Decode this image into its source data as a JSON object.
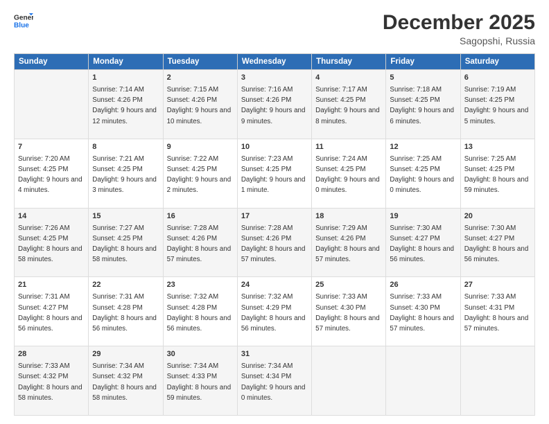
{
  "header": {
    "logo_line1": "General",
    "logo_line2": "Blue",
    "title": "December 2025",
    "subtitle": "Sagopshi, Russia"
  },
  "weekdays": [
    "Sunday",
    "Monday",
    "Tuesday",
    "Wednesday",
    "Thursday",
    "Friday",
    "Saturday"
  ],
  "weeks": [
    [
      {
        "day": "",
        "sunrise": "",
        "sunset": "",
        "daylight": ""
      },
      {
        "day": "1",
        "sunrise": "Sunrise: 7:14 AM",
        "sunset": "Sunset: 4:26 PM",
        "daylight": "Daylight: 9 hours and 12 minutes."
      },
      {
        "day": "2",
        "sunrise": "Sunrise: 7:15 AM",
        "sunset": "Sunset: 4:26 PM",
        "daylight": "Daylight: 9 hours and 10 minutes."
      },
      {
        "day": "3",
        "sunrise": "Sunrise: 7:16 AM",
        "sunset": "Sunset: 4:26 PM",
        "daylight": "Daylight: 9 hours and 9 minutes."
      },
      {
        "day": "4",
        "sunrise": "Sunrise: 7:17 AM",
        "sunset": "Sunset: 4:25 PM",
        "daylight": "Daylight: 9 hours and 8 minutes."
      },
      {
        "day": "5",
        "sunrise": "Sunrise: 7:18 AM",
        "sunset": "Sunset: 4:25 PM",
        "daylight": "Daylight: 9 hours and 6 minutes."
      },
      {
        "day": "6",
        "sunrise": "Sunrise: 7:19 AM",
        "sunset": "Sunset: 4:25 PM",
        "daylight": "Daylight: 9 hours and 5 minutes."
      }
    ],
    [
      {
        "day": "7",
        "sunrise": "Sunrise: 7:20 AM",
        "sunset": "Sunset: 4:25 PM",
        "daylight": "Daylight: 9 hours and 4 minutes."
      },
      {
        "day": "8",
        "sunrise": "Sunrise: 7:21 AM",
        "sunset": "Sunset: 4:25 PM",
        "daylight": "Daylight: 9 hours and 3 minutes."
      },
      {
        "day": "9",
        "sunrise": "Sunrise: 7:22 AM",
        "sunset": "Sunset: 4:25 PM",
        "daylight": "Daylight: 9 hours and 2 minutes."
      },
      {
        "day": "10",
        "sunrise": "Sunrise: 7:23 AM",
        "sunset": "Sunset: 4:25 PM",
        "daylight": "Daylight: 9 hours and 1 minute."
      },
      {
        "day": "11",
        "sunrise": "Sunrise: 7:24 AM",
        "sunset": "Sunset: 4:25 PM",
        "daylight": "Daylight: 9 hours and 0 minutes."
      },
      {
        "day": "12",
        "sunrise": "Sunrise: 7:25 AM",
        "sunset": "Sunset: 4:25 PM",
        "daylight": "Daylight: 9 hours and 0 minutes."
      },
      {
        "day": "13",
        "sunrise": "Sunrise: 7:25 AM",
        "sunset": "Sunset: 4:25 PM",
        "daylight": "Daylight: 8 hours and 59 minutes."
      }
    ],
    [
      {
        "day": "14",
        "sunrise": "Sunrise: 7:26 AM",
        "sunset": "Sunset: 4:25 PM",
        "daylight": "Daylight: 8 hours and 58 minutes."
      },
      {
        "day": "15",
        "sunrise": "Sunrise: 7:27 AM",
        "sunset": "Sunset: 4:25 PM",
        "daylight": "Daylight: 8 hours and 58 minutes."
      },
      {
        "day": "16",
        "sunrise": "Sunrise: 7:28 AM",
        "sunset": "Sunset: 4:26 PM",
        "daylight": "Daylight: 8 hours and 57 minutes."
      },
      {
        "day": "17",
        "sunrise": "Sunrise: 7:28 AM",
        "sunset": "Sunset: 4:26 PM",
        "daylight": "Daylight: 8 hours and 57 minutes."
      },
      {
        "day": "18",
        "sunrise": "Sunrise: 7:29 AM",
        "sunset": "Sunset: 4:26 PM",
        "daylight": "Daylight: 8 hours and 57 minutes."
      },
      {
        "day": "19",
        "sunrise": "Sunrise: 7:30 AM",
        "sunset": "Sunset: 4:27 PM",
        "daylight": "Daylight: 8 hours and 56 minutes."
      },
      {
        "day": "20",
        "sunrise": "Sunrise: 7:30 AM",
        "sunset": "Sunset: 4:27 PM",
        "daylight": "Daylight: 8 hours and 56 minutes."
      }
    ],
    [
      {
        "day": "21",
        "sunrise": "Sunrise: 7:31 AM",
        "sunset": "Sunset: 4:27 PM",
        "daylight": "Daylight: 8 hours and 56 minutes."
      },
      {
        "day": "22",
        "sunrise": "Sunrise: 7:31 AM",
        "sunset": "Sunset: 4:28 PM",
        "daylight": "Daylight: 8 hours and 56 minutes."
      },
      {
        "day": "23",
        "sunrise": "Sunrise: 7:32 AM",
        "sunset": "Sunset: 4:28 PM",
        "daylight": "Daylight: 8 hours and 56 minutes."
      },
      {
        "day": "24",
        "sunrise": "Sunrise: 7:32 AM",
        "sunset": "Sunset: 4:29 PM",
        "daylight": "Daylight: 8 hours and 56 minutes."
      },
      {
        "day": "25",
        "sunrise": "Sunrise: 7:33 AM",
        "sunset": "Sunset: 4:30 PM",
        "daylight": "Daylight: 8 hours and 57 minutes."
      },
      {
        "day": "26",
        "sunrise": "Sunrise: 7:33 AM",
        "sunset": "Sunset: 4:30 PM",
        "daylight": "Daylight: 8 hours and 57 minutes."
      },
      {
        "day": "27",
        "sunrise": "Sunrise: 7:33 AM",
        "sunset": "Sunset: 4:31 PM",
        "daylight": "Daylight: 8 hours and 57 minutes."
      }
    ],
    [
      {
        "day": "28",
        "sunrise": "Sunrise: 7:33 AM",
        "sunset": "Sunset: 4:32 PM",
        "daylight": "Daylight: 8 hours and 58 minutes."
      },
      {
        "day": "29",
        "sunrise": "Sunrise: 7:34 AM",
        "sunset": "Sunset: 4:32 PM",
        "daylight": "Daylight: 8 hours and 58 minutes."
      },
      {
        "day": "30",
        "sunrise": "Sunrise: 7:34 AM",
        "sunset": "Sunset: 4:33 PM",
        "daylight": "Daylight: 8 hours and 59 minutes."
      },
      {
        "day": "31",
        "sunrise": "Sunrise: 7:34 AM",
        "sunset": "Sunset: 4:34 PM",
        "daylight": "Daylight: 9 hours and 0 minutes."
      },
      {
        "day": "",
        "sunrise": "",
        "sunset": "",
        "daylight": ""
      },
      {
        "day": "",
        "sunrise": "",
        "sunset": "",
        "daylight": ""
      },
      {
        "day": "",
        "sunrise": "",
        "sunset": "",
        "daylight": ""
      }
    ]
  ]
}
